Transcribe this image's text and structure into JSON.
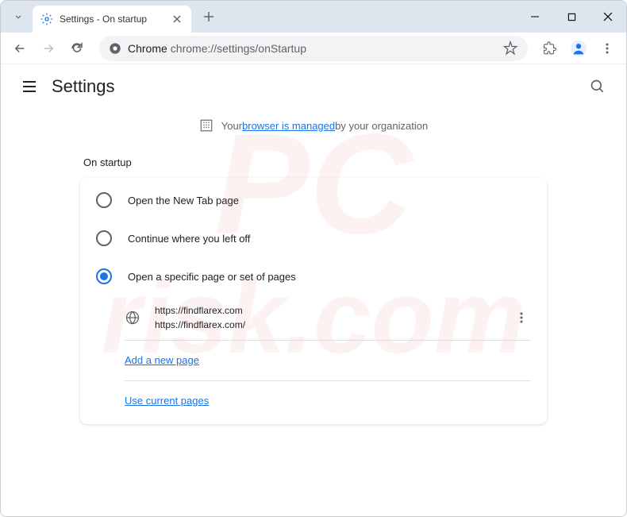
{
  "window": {
    "tab_title": "Settings - On startup"
  },
  "omnibox": {
    "prefix": "Chrome",
    "url": "chrome://settings/onStartup"
  },
  "settings": {
    "title": "Settings",
    "managed_prefix": "Your ",
    "managed_link": "browser is managed",
    "managed_suffix": " by your organization",
    "section_title": "On startup",
    "options": {
      "new_tab": "Open the New Tab page",
      "continue": "Continue where you left off",
      "specific": "Open a specific page or set of pages"
    },
    "startup_page": {
      "title": "https://findflarex.com",
      "url": "https://findflarex.com/"
    },
    "add_page": "Add a new page",
    "use_current": "Use current pages"
  }
}
